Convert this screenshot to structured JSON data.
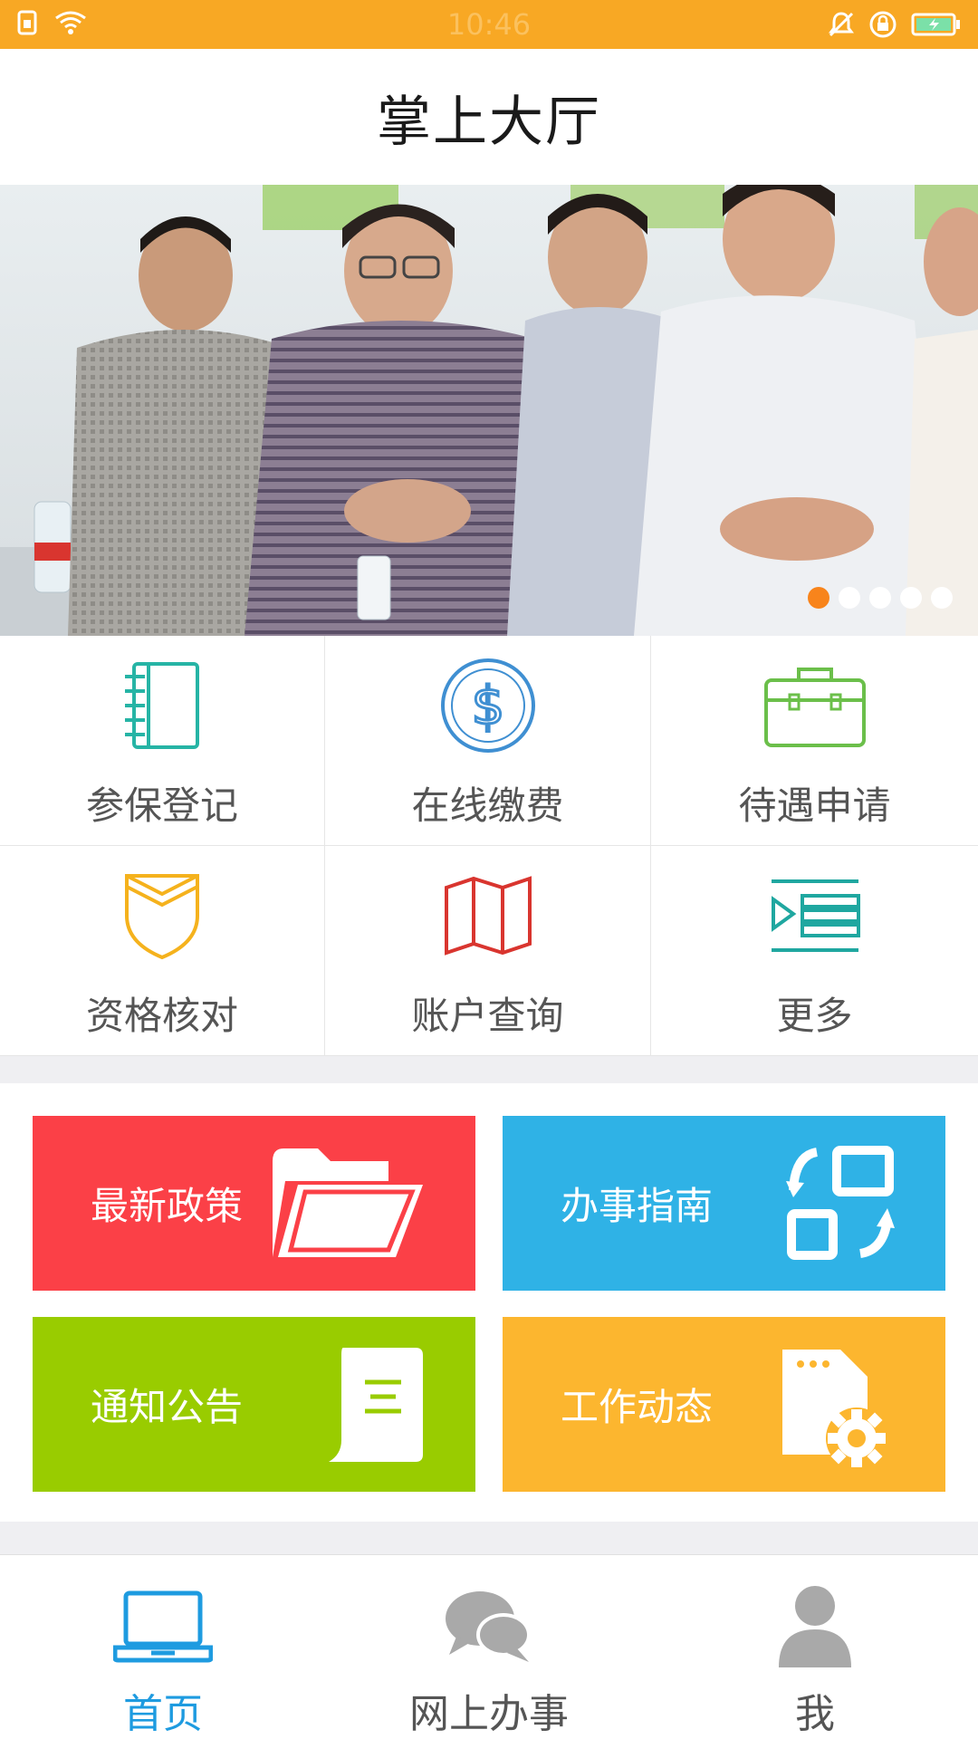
{
  "status_bar": {
    "time": "10:46",
    "background": "#f8a824"
  },
  "header": {
    "title": "掌上大厅"
  },
  "banner": {
    "slide_count": 5,
    "active_index": 0
  },
  "services": [
    {
      "label": "参保登记",
      "icon": "notebook-icon",
      "color": "#26b4a5"
    },
    {
      "label": "在线缴费",
      "icon": "dollar-coin-icon",
      "color": "#3f8fd2"
    },
    {
      "label": "待遇申请",
      "icon": "briefcase-icon",
      "color": "#6bbf4a"
    },
    {
      "label": "资格核对",
      "icon": "shield-icon",
      "color": "#f5b21d"
    },
    {
      "label": "账户查询",
      "icon": "map-icon",
      "color": "#d9352f"
    },
    {
      "label": "更多",
      "icon": "list-icon",
      "color": "#1fa7a0"
    }
  ],
  "tiles": [
    {
      "label": "最新政策",
      "icon": "folder-icon",
      "color": "#fb4047"
    },
    {
      "label": "办事指南",
      "icon": "swap-boxes-icon",
      "color": "#2fb2e6"
    },
    {
      "label": "通知公告",
      "icon": "document-icon",
      "color": "#99cc00"
    },
    {
      "label": "工作动态",
      "icon": "file-settings-icon",
      "color": "#fcb62f"
    }
  ],
  "bottom_nav": [
    {
      "label": "首页",
      "icon": "laptop-icon",
      "active": true
    },
    {
      "label": "网上办事",
      "icon": "chat-bubbles-icon",
      "active": false
    },
    {
      "label": "我",
      "icon": "person-icon",
      "active": false
    }
  ],
  "colors": {
    "accent": "#1e9be0",
    "indicator_active": "#f8841b"
  }
}
